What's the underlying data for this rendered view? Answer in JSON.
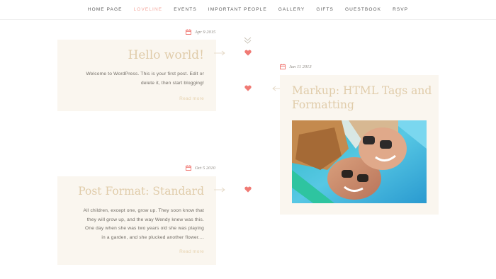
{
  "nav": {
    "items": [
      {
        "label": "HOME PAGE",
        "active": false
      },
      {
        "label": "LOVELINE",
        "active": true
      },
      {
        "label": "EVENTS",
        "active": false
      },
      {
        "label": "IMPORTANT PEOPLE",
        "active": false
      },
      {
        "label": "GALLERY",
        "active": false
      },
      {
        "label": "GIFTS",
        "active": false
      },
      {
        "label": "GUESTBOOK",
        "active": false
      },
      {
        "label": "RSVP",
        "active": false
      }
    ]
  },
  "posts": [
    {
      "date": "Apr 9 2015",
      "title": "Hello world!",
      "excerpt_lines": [
        "Welcome to WordPress. This is your first post. Edit or",
        "delete it, then start blogging!"
      ],
      "read_more": "Read more"
    },
    {
      "date": "Jan 11 2013",
      "title_lines": [
        "Markup: HTML Tags and",
        "Formatting"
      ]
    },
    {
      "date": "Oct 5 2010",
      "title": "Post Format: Standard",
      "excerpt_lines": [
        "All children, except one, grow up. They soon know that",
        "they will grow up, and the way Wendy knew was this.",
        "One day when she was two years old she was playing",
        "in a garden, and she plucked another flower...."
      ],
      "read_more": "Read more"
    }
  ],
  "colors": {
    "accent": "#f3a49a",
    "heart": "#f07a74",
    "card_bg": "#faf6ef",
    "title": "#e0ccaa"
  },
  "icons": [
    "calendar-icon",
    "heart-icon",
    "chevron-double-down-icon",
    "arrow-right-icon",
    "arrow-left-icon"
  ]
}
